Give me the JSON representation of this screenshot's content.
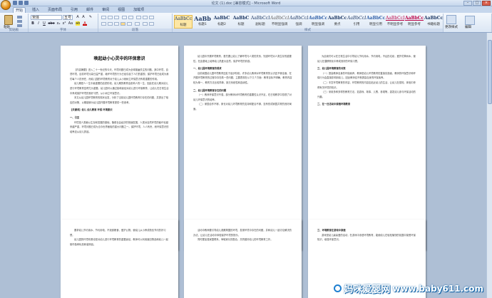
{
  "window": {
    "title": "论文 (1).doc [兼容模式] - Microsoft Word",
    "controls": {
      "minimize": "–",
      "maximize": "□",
      "close": "×"
    }
  },
  "tabs": [
    {
      "label": "开始",
      "active": true
    },
    {
      "label": "插入"
    },
    {
      "label": "页面布局"
    },
    {
      "label": "引用"
    },
    {
      "label": "邮件"
    },
    {
      "label": "审阅"
    },
    {
      "label": "视图"
    },
    {
      "label": "加载项"
    }
  ],
  "ribbon": {
    "clipboard": {
      "paste_label": "粘贴",
      "group_label": "剪贴板"
    },
    "font": {
      "name": "宋体",
      "size": "五号",
      "group_label": "字体",
      "buttons": [
        "B",
        "I",
        "U",
        "abe",
        "x₂",
        "x²",
        "Aa",
        "A"
      ]
    },
    "paragraph": {
      "group_label": "段落"
    },
    "styles": {
      "group_label": "样式",
      "items": [
        {
          "sample": "AaBbCcDc",
          "name": "标题"
        },
        {
          "sample": "AaBb",
          "name": "标题1"
        },
        {
          "sample": "AaBbC",
          "name": "标题2"
        },
        {
          "sample": "AaBbC",
          "name": "标题"
        },
        {
          "sample": "AaBbCcD",
          "name": "副标题"
        },
        {
          "sample": "AaBbCcDc",
          "name": "不明显强调"
        },
        {
          "sample": "AaBbCcDc",
          "name": "强调"
        },
        {
          "sample": "AaBbCcDc",
          "name": "明显强调"
        },
        {
          "sample": "AaBbCcDc",
          "name": "要点"
        },
        {
          "sample": "AaBbCcDc",
          "name": "引用"
        },
        {
          "sample": "AaBbCcDc",
          "name": "明显引用"
        },
        {
          "sample": "AaBbCcDc",
          "name": "不明显参考"
        },
        {
          "sample": "AaBbCcDc",
          "name": "明显参考"
        },
        {
          "sample": "AaBbCcDc",
          "name": "书籍标题"
        }
      ]
    },
    "editing": {
      "label": "编辑",
      "change_styles": "更改样式"
    }
  },
  "pages": {
    "p1": {
      "title": "唤起幼小心灵中的环保意识",
      "paragraphs": [
        "【内容摘要】进入二十一世纪的今天，环境问题已成为全球普遍关注的问题，其中环境，自然环境，目前环境污染日益严重，破坏环境的行为已经引起了人们的重视，保护环境已经成为我们每个人的责任，而幼儿园的环境教育对于幼儿从小就树立环保意识有着重要的作用。",
        "幼儿期是人一生中最重要的启蒙阶段，幼儿期的教育会影响人的一生，因此在幼儿期对幼儿进行环境教育显得尤为重要。幼儿园可以通过各种途径对幼儿进行环保教育，让幼儿在日常生活中养成保护环境的良好习惯，从小树立环保意识。",
        "本文从幼儿园环境教育的现状出发，分析了当前幼儿园环境教育中存在的问题，并提出了相应的对策，以期能够为幼儿园开展环境教育提供一些参考。",
        "【关键词】幼儿 幼儿教育 环保 环境意识",
        "一、引言",
        "环境是人类赖以生存和发展的基础，随着社会经济的快速发展，人类对自然环境的破坏也越来越严重，环境问题已成为当今世界面临的重大问题之一。保护环境，人人有责，而环保意识的培养应从幼儿抓起。"
      ]
    },
    "p2": {
      "paragraphs": [
        "幼儿园中开展环境教育，首先要让幼儿了解环境与人类的关系，知道环境对人类生存的重要性，在此基础上培养幼儿热爱大自然、保护环境的情感。",
        "一、幼儿园环境教育的现状",
        "目前我国幼儿园环境教育还处于起步阶段，许多幼儿教师对环境教育的认识还不够全面，在开展环境教育的过程中存在着一些问题，主要表现在以下几个方面：教育目标不明确，教育内容较为单一，教育方法比较简单，缺乏系统性和连续性。",
        "二、幼儿园环境教育存在的问题",
        "（一）教师环保意识不强，部分教师对环境教育的重要性认识不足，在日常教学中忽视了对幼儿环保意识的培养。",
        "（二）家园合作不够，家长对幼儿环境教育的支持和配合不够，没有形成家园共育的良好局面。"
      ]
    },
    "p3": {
      "paragraphs": [
        "为此我们可以在日常生活中引导幼儿节约用水、节约用电，不乱扔垃圾，爱护花草树木，使幼儿在潜移默化中养成良好的环保习惯。",
        "三、幼儿园环境教育的对策",
        "（一）提高教师自身的环保素养，教师是幼儿环境教育的直接实施者，教师的环保意识和环保行为会直接影响到幼儿，因此教师应不断提高自身的环保素养。",
        "（二）丰富环境教育的内容，环境教育的内容应贴近幼儿的生活，让幼儿在感知、体验中获得有关环境的知识。",
        "（三）采用多种多样的教育方法，如游戏、故事、儿歌、参观等，激发幼儿参与环保活动的兴趣。",
        "二、在一日活动中渗透环境教育"
      ]
    },
    "p4": {
      "paragraphs": [
        "要求幼儿节约用水、节约用电，不浪费粮食，爱护公物，使幼儿从小养成勤俭节约的好习惯。",
        "幼儿园的环境布置也是对幼儿进行环境教育的重要途径，教师可以利用废旧物品和幼儿一起制作各种玩具和装饰品。"
      ]
    },
    "p5": {
      "paragraphs": [
        "活动中教师要引导幼儿观察周围的环境，发现环境中存在的问题，并和幼儿一起讨论解决的办法，让幼儿在活动中体验保护环境的快乐。",
        "同时要加强家园联系，争取家长的配合，共同做好幼儿的环境教育工作。"
      ]
    },
    "p6": {
      "paragraphs": [
        "三、环境教育在游戏中渗透",
        "游戏是幼儿最喜爱的活动，在游戏中渗透环境教育，能使幼儿在轻松愉快的氛围中接受环保知识，增强环保意识。"
      ]
    }
  },
  "watermark": {
    "cn": "妈咪爱婴网",
    "url": "www.baby611.com"
  }
}
